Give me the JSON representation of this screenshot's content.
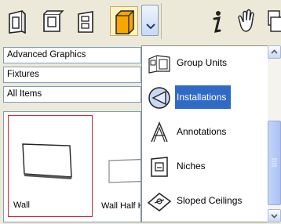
{
  "toolbar": {
    "icons": [
      "view-front-icon",
      "view-side-icon",
      "view-plan-icon",
      "object-3d-icon",
      "dropdown-arrow-icon",
      "info-icon",
      "pan-hand-icon",
      "more-icon"
    ]
  },
  "filters": {
    "category": "Advanced Graphics",
    "subcategory": "Fixtures",
    "scope": "All Items"
  },
  "gallery": {
    "items": [
      {
        "label": "Wall"
      },
      {
        "label": "Wall Half Height"
      }
    ]
  },
  "menu": {
    "items": [
      {
        "label": "Group Units",
        "icon": "group-units-icon"
      },
      {
        "label": "Installations",
        "icon": "installations-icon"
      },
      {
        "label": "Annotations",
        "icon": "annotations-icon"
      },
      {
        "label": "Niches",
        "icon": "niches-icon"
      },
      {
        "label": "Sloped Ceilings",
        "icon": "sloped-ceilings-icon"
      }
    ],
    "selected": "Installations"
  },
  "colors": {
    "accent": "#316ac5",
    "selection_border": "#d9262f",
    "active_tool": "#f7a700"
  }
}
